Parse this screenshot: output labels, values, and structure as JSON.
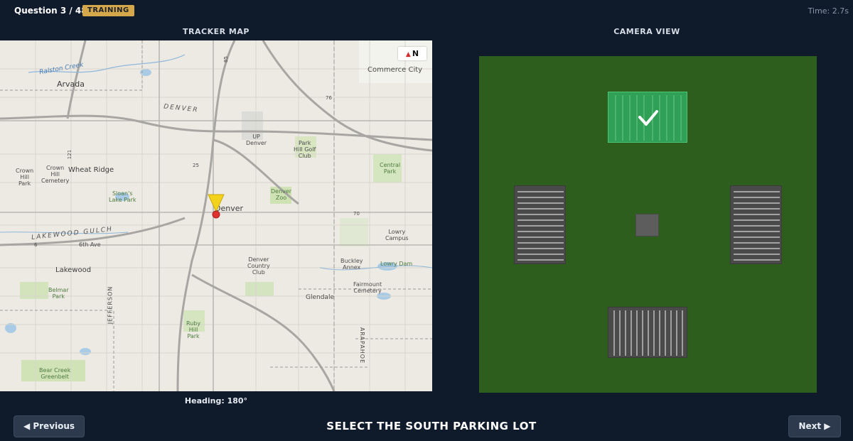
{
  "header": {
    "question_counter": "Question 3 / 48",
    "mode_badge": "TRAINING",
    "timer": "Time: 2.7s"
  },
  "tracker": {
    "title": "TRACKER MAP",
    "north_label": "N",
    "heading": "Heading: 180°",
    "labels": {
      "arvada": "Arvada",
      "commerce_city": "Commerce City",
      "ralston_creek": "Ralston Creek",
      "denver_road": "DENVER",
      "up_denver": "UP\nDenver",
      "park_hill": "Park\nHill Golf\nClub",
      "central_park": "Central\nPark",
      "crown_hill_park": "Crown\nHill\nPark",
      "crown_hill_cemetery": "Crown\nHill\nCemetery",
      "wheat_ridge": "Wheat Ridge",
      "sloans_lake": "Sloan's\nLake Park",
      "denver_zoo": "Denver\nZoo",
      "denver": "Denver",
      "lakewood_gulch": "LAKEWOOD GULCH",
      "sixth_ave": "6th Ave",
      "lowry_campus": "Lowry\nCampus",
      "lakewood": "Lakewood",
      "denver_country_club": "Denver\nCountry\nClub",
      "buckley_annex": "Buckley\nAnnex",
      "lowry_dam": "Lowry Dam",
      "belmar_park": "Belmar\nPark",
      "jefferson": "JEFFERSON",
      "fairmount_cemetery": "Fairmount\nCemetery",
      "glendale": "Glendale",
      "ruby_hill_park": "Ruby\nHill\nPark",
      "arapahoe": "ARAPAHOE",
      "bear_creek_greenbelt": "Bear Creek\nGreenbelt",
      "route_25": "25",
      "route_70": "70",
      "route_76": "76",
      "route_121": "121",
      "route_6": "6",
      "route_85": "85"
    }
  },
  "camera": {
    "title": "CAMERA VIEW"
  },
  "footer": {
    "previous_label": "◀ Previous",
    "next_label": "Next ▶",
    "instruction": "SELECT THE SOUTH PARKING LOT"
  },
  "colors": {
    "background": "#0f1a2b",
    "badge": "#d4a84a",
    "camera_ground": "#2e5e1e",
    "selected_field": "#2fa055",
    "parking_lot": "#4a4a4a",
    "marker_yellow": "#f2d21b",
    "marker_red": "#e03131"
  },
  "icons": {
    "north": "north-arrow-icon",
    "checkmark": "checkmark-icon",
    "position": "position-marker-icon"
  }
}
